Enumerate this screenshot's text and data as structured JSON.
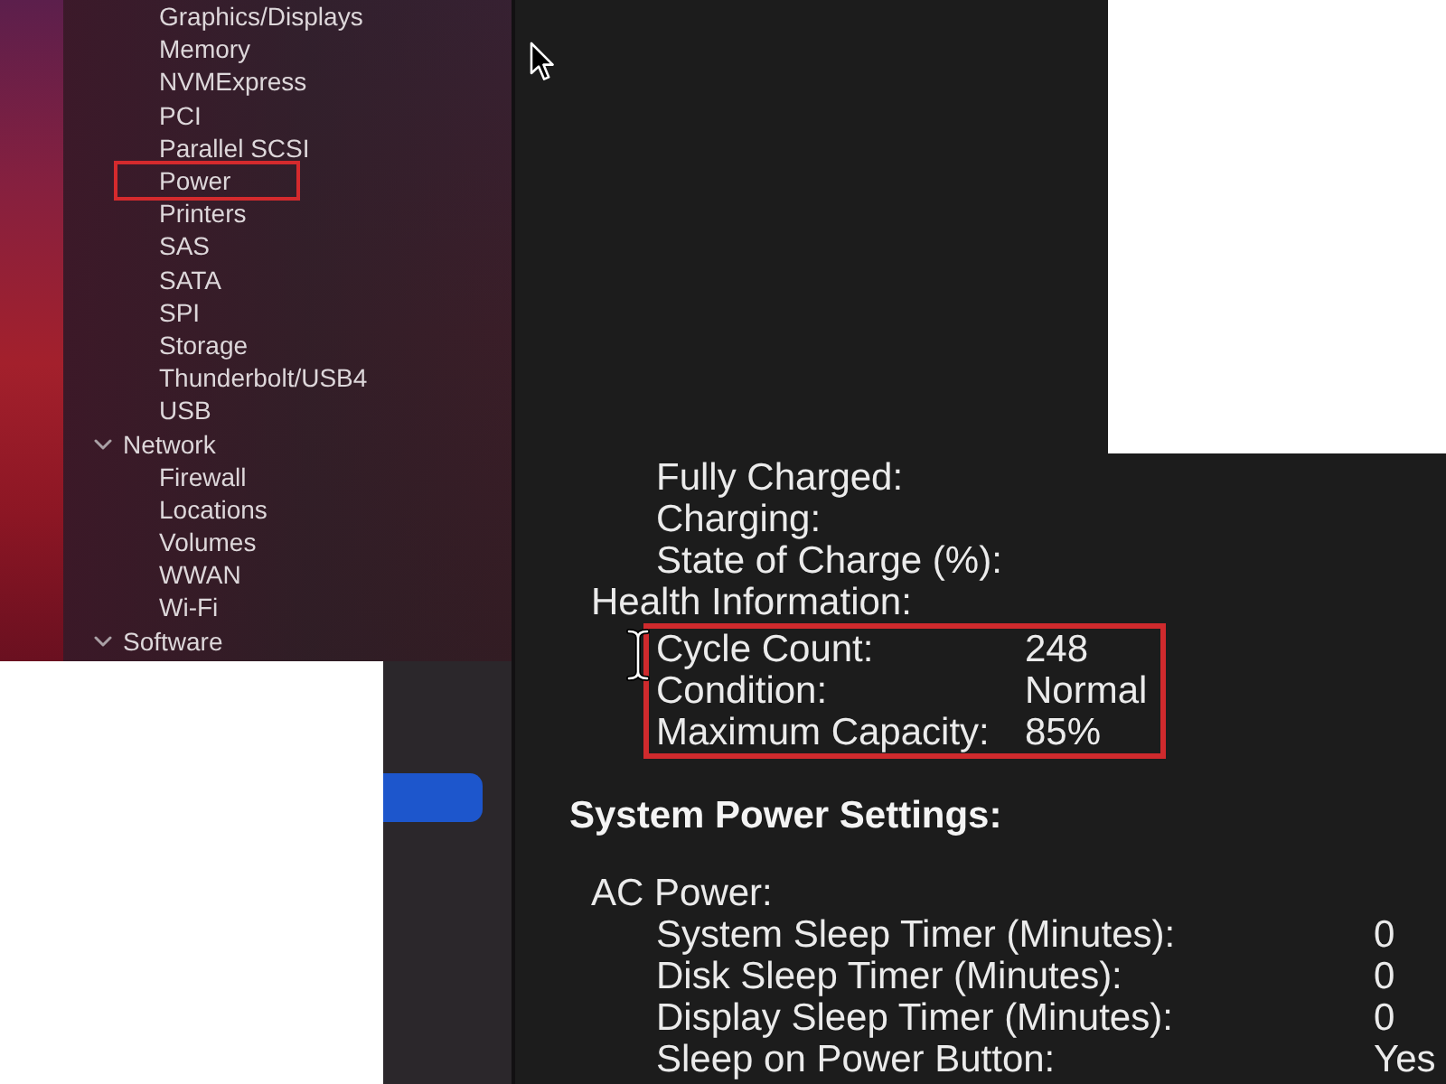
{
  "sidebar": {
    "items": [
      {
        "label": "Graphics/Displays",
        "highlighted": false
      },
      {
        "label": "Memory",
        "highlighted": false
      },
      {
        "label": "NVMExpress",
        "highlighted": false
      },
      {
        "label": "PCI",
        "highlighted": false
      },
      {
        "label": "Parallel SCSI",
        "highlighted": false
      },
      {
        "label": "Power",
        "highlighted": true
      },
      {
        "label": "Printers",
        "highlighted": false
      },
      {
        "label": "SAS",
        "highlighted": false
      },
      {
        "label": "SATA",
        "highlighted": false
      },
      {
        "label": "SPI",
        "highlighted": false
      },
      {
        "label": "Storage",
        "highlighted": false
      },
      {
        "label": "Thunderbolt/USB4",
        "highlighted": false
      },
      {
        "label": "USB",
        "highlighted": false
      }
    ],
    "sections": [
      {
        "label": "Network",
        "expanded": true,
        "children": [
          {
            "label": "Firewall",
            "highlighted": false
          },
          {
            "label": "Locations",
            "highlighted": false
          },
          {
            "label": "Volumes",
            "highlighted": false
          },
          {
            "label": "WWAN",
            "highlighted": false
          },
          {
            "label": "Wi-Fi",
            "highlighted": false
          }
        ]
      },
      {
        "label": "Software",
        "expanded": true
      }
    ]
  },
  "lower_sidebar": {
    "row_selected": true
  },
  "battery_details": {
    "rows": [
      {
        "label": "Fully Charged:"
      },
      {
        "label": "Charging:"
      },
      {
        "label": "State of Charge (%):"
      }
    ]
  },
  "health_information": {
    "label": "Health Information:",
    "highlighted": true,
    "rows": [
      {
        "label": "Cycle Count:",
        "value": "248"
      },
      {
        "label": "Condition:",
        "value": "Normal"
      },
      {
        "label": "Maximum Capacity:",
        "value": "85%"
      }
    ]
  },
  "system_power_settings": {
    "title": "System Power Settings:",
    "ac_power": {
      "label": "AC Power:",
      "rows": [
        {
          "label": "System Sleep Timer (Minutes):",
          "value": "0"
        },
        {
          "label": "Disk Sleep Timer (Minutes):",
          "value": "0"
        },
        {
          "label": "Display Sleep Timer (Minutes):",
          "value": "0"
        },
        {
          "label": "Sleep on Power Button:",
          "value": "Yes"
        }
      ]
    }
  }
}
